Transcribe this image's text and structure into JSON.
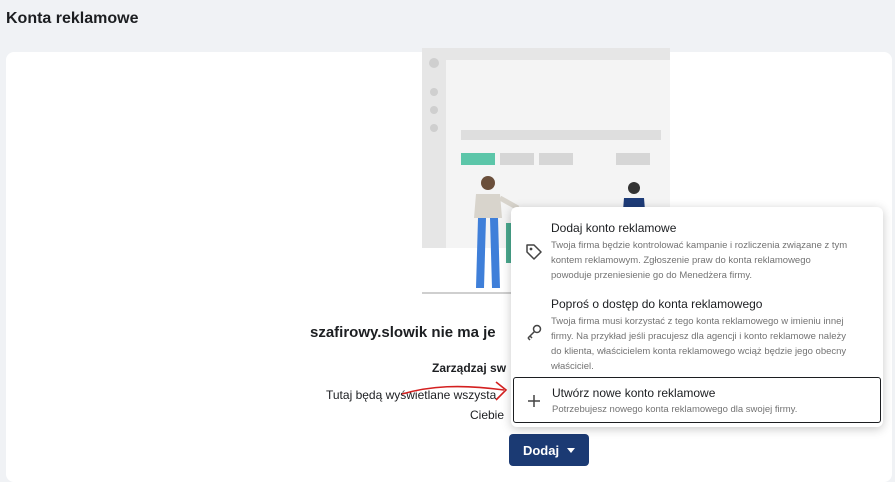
{
  "page": {
    "title": "Konta reklamowe"
  },
  "empty_state": {
    "heading": "szafirowy.slowik nie ma je",
    "subheading": "Zarządzaj sw",
    "description_line1": "Tutaj będą wyświetlane wszysta",
    "description_line2": "Ciebie"
  },
  "add_button": {
    "label": "Dodaj"
  },
  "dropdown": {
    "items": [
      {
        "title": "Dodaj konto reklamowe",
        "description": "Twoja firma będzie kontrolować kampanie i rozliczenia związane z tym kontem reklamowym. Zgłoszenie praw do konta reklamowego powoduje przeniesienie go do Menedżera firmy.",
        "icon": "tag-icon"
      },
      {
        "title": "Poproś o dostęp do konta reklamowego",
        "description": "Twoja firma musi korzystać z tego konta reklamowego w imieniu innej firmy. Na przykład jeśli pracujesz dla agencji i konto reklamowe należy do klienta, właścicielem konta reklamowego wciąż będzie jego obecny właściciel.",
        "icon": "key-icon"
      },
      {
        "title": "Utwórz nowe konto reklamowe",
        "description": "Potrzebujesz nowego konta reklamowego dla swojej firmy.",
        "icon": "plus-icon"
      }
    ]
  },
  "colors": {
    "primary_button": "#1b3a73",
    "page_background": "#f0f2f5",
    "annotation_red": "#d42020"
  }
}
